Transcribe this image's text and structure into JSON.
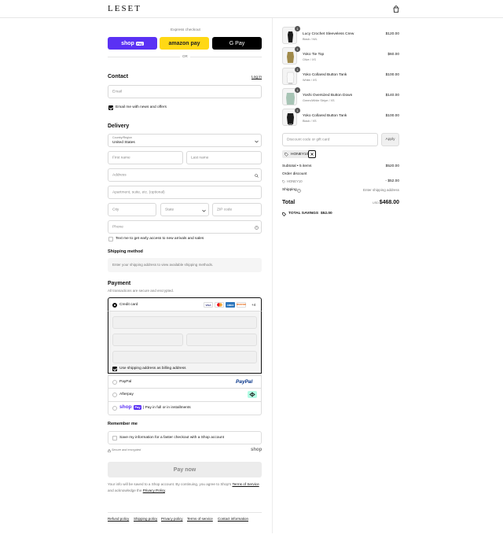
{
  "header": {
    "logo": "LESET"
  },
  "express": {
    "title": "Express checkout",
    "or": "OR",
    "shop_label": "shop",
    "shop_badge": "Pay",
    "amazon_label": "amazon pay",
    "gpay_label": "G Pay",
    "colors": {
      "shop": "#5a31f4",
      "amazon": "#ffd814",
      "gpay": "#000000"
    }
  },
  "contact": {
    "title": "Contact",
    "login": "Log in",
    "email_placeholder": "Email",
    "news_label": "Email me with news and offers",
    "news_checked": true
  },
  "delivery": {
    "title": "Delivery",
    "country_label": "Country/Region",
    "country_value": "United States",
    "first_name": "First name",
    "last_name": "Last name",
    "address": "Address",
    "apartment": "Apartment, suite, etc. (optional)",
    "city": "City",
    "state": "State",
    "zip": "ZIP code",
    "phone": "Phone",
    "sms_label": "Text me to get early access to new arrivals and sales"
  },
  "shipping_method": {
    "title": "Shipping method",
    "message": "Enter your shipping address to view available shipping methods."
  },
  "payment": {
    "title": "Payment",
    "subtitle": "All transactions are secure and encrypted.",
    "credit_card": "Credit card",
    "more_cards": "+4",
    "card_icons": [
      "VISA",
      "MC",
      "AMEX",
      "DISCOVER"
    ],
    "billing_label": "Use shipping address as billing address",
    "paypal": "PayPal",
    "paypal_logo": "PayPal",
    "afterpay": "Afterpay",
    "shoppay_badge": "shop",
    "shoppay_badge2": "Pay",
    "shoppay_text": "| Pay in full or in installments"
  },
  "remember": {
    "title": "Remember me",
    "save_label": "Save my information for a faster checkout with a Shop account",
    "secure": "Secure and encrypted",
    "shop_logo": "shop"
  },
  "pay_button": "Pay now",
  "legal": {
    "text1": "Your info will be saved to a Shop account. By continuing, you agree to Shop's ",
    "terms": "Terms of Service",
    "text2": "and acknowledge the ",
    "privacy": "Privacy Policy",
    "period": "."
  },
  "footer_links": [
    "Refund policy",
    "Shipping policy",
    "Privacy policy",
    "Terms of service",
    "Contact information"
  ],
  "cart": {
    "items": [
      {
        "qty": "1",
        "name": "Lucy Crochet Sleeveless Crew",
        "variant": "Black / M/L",
        "price": "$120.00"
      },
      {
        "qty": "1",
        "name": "Yoko Tie Top",
        "variant": "Olive / XS",
        "price": "$60.00"
      },
      {
        "qty": "1",
        "name": "Yoko Collared Button Tank",
        "variant": "White / XS",
        "price": "$100.00"
      },
      {
        "qty": "1",
        "name": "Yoshi Oversized Button Down",
        "variant": "Green/White Stripe / XS",
        "price": "$140.00"
      },
      {
        "qty": "1",
        "name": "Yoko Collared Button Tank",
        "variant": "Black / XS",
        "price": "$100.00"
      }
    ],
    "discount_placeholder": "Discount code or gift card",
    "apply": "Apply",
    "code_tag": "HONEY10",
    "subtotal_label": "Subtotal • 5 items",
    "subtotal": "$520.00",
    "order_discount_label": "Order discount",
    "discount_code": "HONEY10",
    "discount_amount": "- $52.00",
    "shipping_label": "Shipping",
    "shipping_value": "Enter shipping address",
    "total_label": "Total",
    "currency": "USD",
    "total": "$468.00",
    "savings_label": "TOTAL SAVINGS",
    "savings": "$52.00"
  }
}
